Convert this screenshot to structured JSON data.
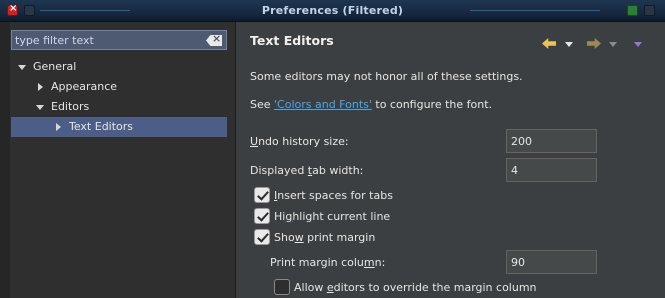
{
  "window": {
    "title": "Preferences (Filtered)"
  },
  "filter": {
    "placeholder": "type filter text"
  },
  "tree": {
    "general": "General",
    "appearance": "Appearance",
    "editors": "Editors",
    "text_editors": "Text Editors"
  },
  "page": {
    "title": "Text Editors",
    "note": "Some editors may not honor all of these settings.",
    "see_prefix": "See ",
    "link": "'Colors and Fonts'",
    "see_suffix": " to configure the font."
  },
  "settings": {
    "undo": {
      "label_pre": "",
      "label_u": "U",
      "label_post": "ndo history size:",
      "value": "200"
    },
    "tab_width": {
      "label_pre": "Displayed ",
      "label_u": "t",
      "label_post": "ab width:",
      "value": "4"
    },
    "insert_spaces": {
      "label_pre": "",
      "label_u": "I",
      "label_post": "nsert spaces for tabs",
      "checked": true
    },
    "highlight_line": {
      "label_pre": "Hi",
      "label_u": "g",
      "label_post": "hlight current line",
      "checked": true
    },
    "print_margin": {
      "label_pre": "Sho",
      "label_u": "w",
      "label_post": " print margin",
      "checked": true
    },
    "margin_column": {
      "label_pre": "Print margin colu",
      "label_u": "m",
      "label_post": "n:",
      "value": "90"
    },
    "allow_override": {
      "label_pre": "Allow ",
      "label_u": "e",
      "label_post": "ditors to override the margin column",
      "checked": false
    }
  },
  "colors": {
    "selection": "#4c5d88",
    "link": "#4aa7e8",
    "back_arrow": "#e8c25a"
  }
}
